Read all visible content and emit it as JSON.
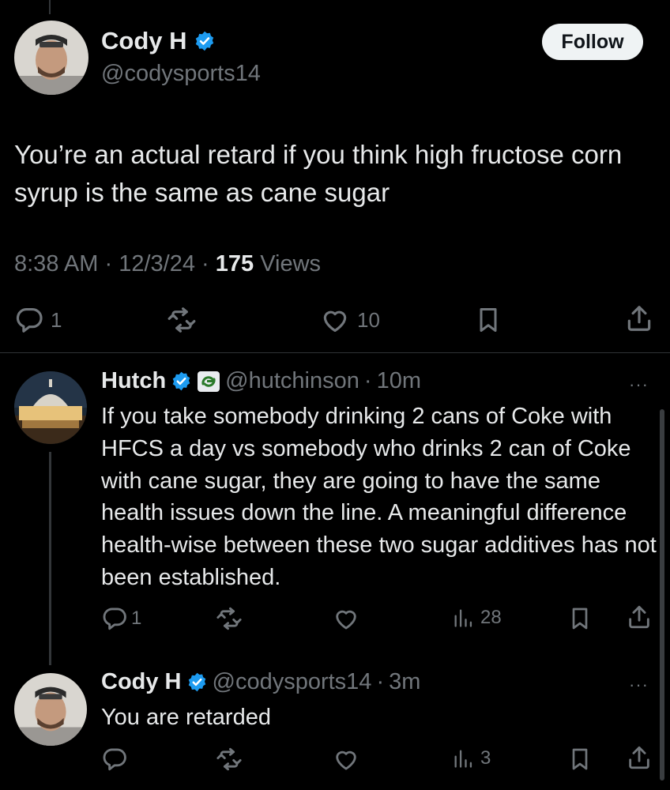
{
  "main_tweet": {
    "name": "Cody H",
    "handle": "@codysports14",
    "follow_label": "Follow",
    "text": "You’re an actual retard if you think high fructose corn syrup is the same as cane sugar",
    "time": "8:38 AM",
    "date": "12/3/24",
    "views_count": "175",
    "views_label": "Views",
    "separator": "·",
    "actions": {
      "replies": "1",
      "likes": "10"
    }
  },
  "replies": [
    {
      "name": "Hutch",
      "handle": "@hutchinson",
      "separator": "·",
      "time": "10m",
      "text": "If you take somebody drinking 2 cans of Coke with HFCS a day vs somebody who drinks 2 can of Coke with cane sugar, they are going to have the same health issues down the line. A meaningful difference health-wise between these two sugar additives has not been established.",
      "actions": {
        "replies": "1",
        "views": "28"
      }
    },
    {
      "name": "Cody H",
      "handle": "@codysports14",
      "separator": "·",
      "time": "3m",
      "text": "You are retarded",
      "actions": {
        "views": "3"
      }
    }
  ],
  "more_glyph": "···",
  "colors": {
    "background": "#000000",
    "text": "#e7e9ea",
    "muted": "#71767b",
    "verified": "#1d9bf0",
    "divider": "#2f3336"
  },
  "icons": [
    "verified-badge-icon",
    "reply-icon",
    "retweet-icon",
    "like-icon",
    "bookmark-icon",
    "share-icon",
    "views-icon",
    "affiliate-badge-icon",
    "more-icon"
  ]
}
